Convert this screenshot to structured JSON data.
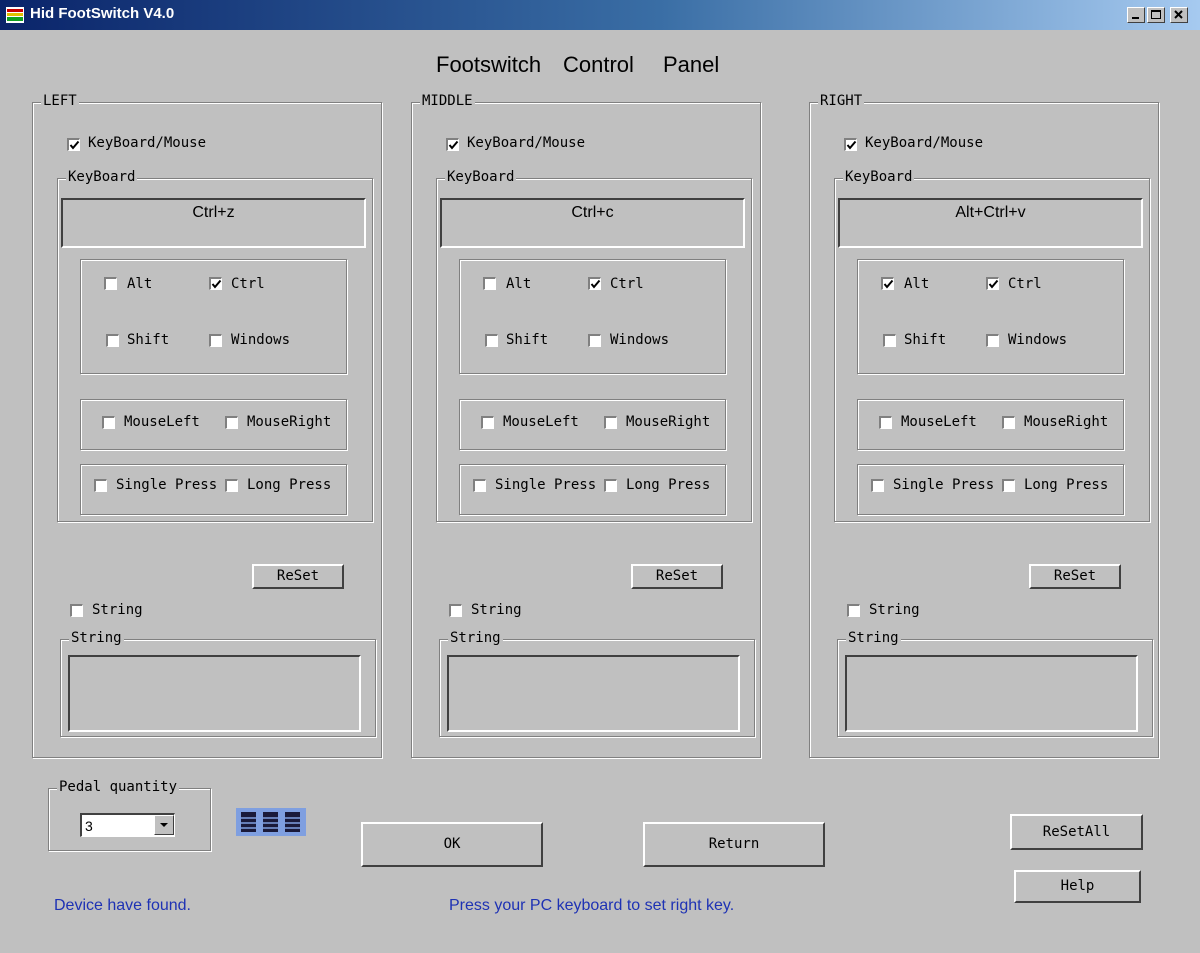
{
  "window": {
    "title": "Hid FootSwitch V4.0"
  },
  "heading": {
    "word1": "Footswitch",
    "word2": "Control",
    "word3": "Panel"
  },
  "panels": [
    {
      "legend": "LEFT",
      "keyboard_mouse_label": "KeyBoard/Mouse",
      "keyboard_mouse_checked": true,
      "keyboard_legend": "KeyBoard",
      "key_value": "Ctrl+z",
      "modifiers": {
        "alt": false,
        "ctrl": true,
        "shift": false,
        "windows": false
      },
      "mouse": {
        "left": false,
        "right": false
      },
      "press": {
        "single": false,
        "long": false
      },
      "reset_label": "ReSet",
      "string_label": "String",
      "string_checked": false,
      "string_legend": "String",
      "string_value": ""
    },
    {
      "legend": "MIDDLE",
      "keyboard_mouse_label": "KeyBoard/Mouse",
      "keyboard_mouse_checked": true,
      "keyboard_legend": "KeyBoard",
      "key_value": "Ctrl+c",
      "modifiers": {
        "alt": false,
        "ctrl": true,
        "shift": false,
        "windows": false
      },
      "mouse": {
        "left": false,
        "right": false
      },
      "press": {
        "single": false,
        "long": false
      },
      "reset_label": "ReSet",
      "string_label": "String",
      "string_checked": false,
      "string_legend": "String",
      "string_value": ""
    },
    {
      "legend": "RIGHT",
      "keyboard_mouse_label": "KeyBoard/Mouse",
      "keyboard_mouse_checked": true,
      "keyboard_legend": "KeyBoard",
      "key_value": "Alt+Ctrl+v",
      "modifiers": {
        "alt": true,
        "ctrl": true,
        "shift": false,
        "windows": false
      },
      "mouse": {
        "left": false,
        "right": false
      },
      "press": {
        "single": false,
        "long": false
      },
      "reset_label": "ReSet",
      "string_label": "String",
      "string_checked": false,
      "string_legend": "String",
      "string_value": ""
    }
  ],
  "labels": {
    "alt": "Alt",
    "ctrl": "Ctrl",
    "shift": "Shift",
    "windows": "Windows",
    "mouse_left": "MouseLeft",
    "mouse_right": "MouseRight",
    "single_press": "Single Press",
    "long_press": "Long Press"
  },
  "pedal": {
    "legend": "Pedal quantity",
    "value": "3"
  },
  "buttons": {
    "ok": "OK",
    "return": "Return",
    "reset_all": "ReSetAll",
    "help": "Help"
  },
  "status": {
    "device": "Device have found.",
    "hint": "Press your PC keyboard to set right key."
  },
  "colors": {
    "status_text": "#1e32b4",
    "titlebar_start": "#0a246a",
    "face": "#c0c0c0"
  }
}
